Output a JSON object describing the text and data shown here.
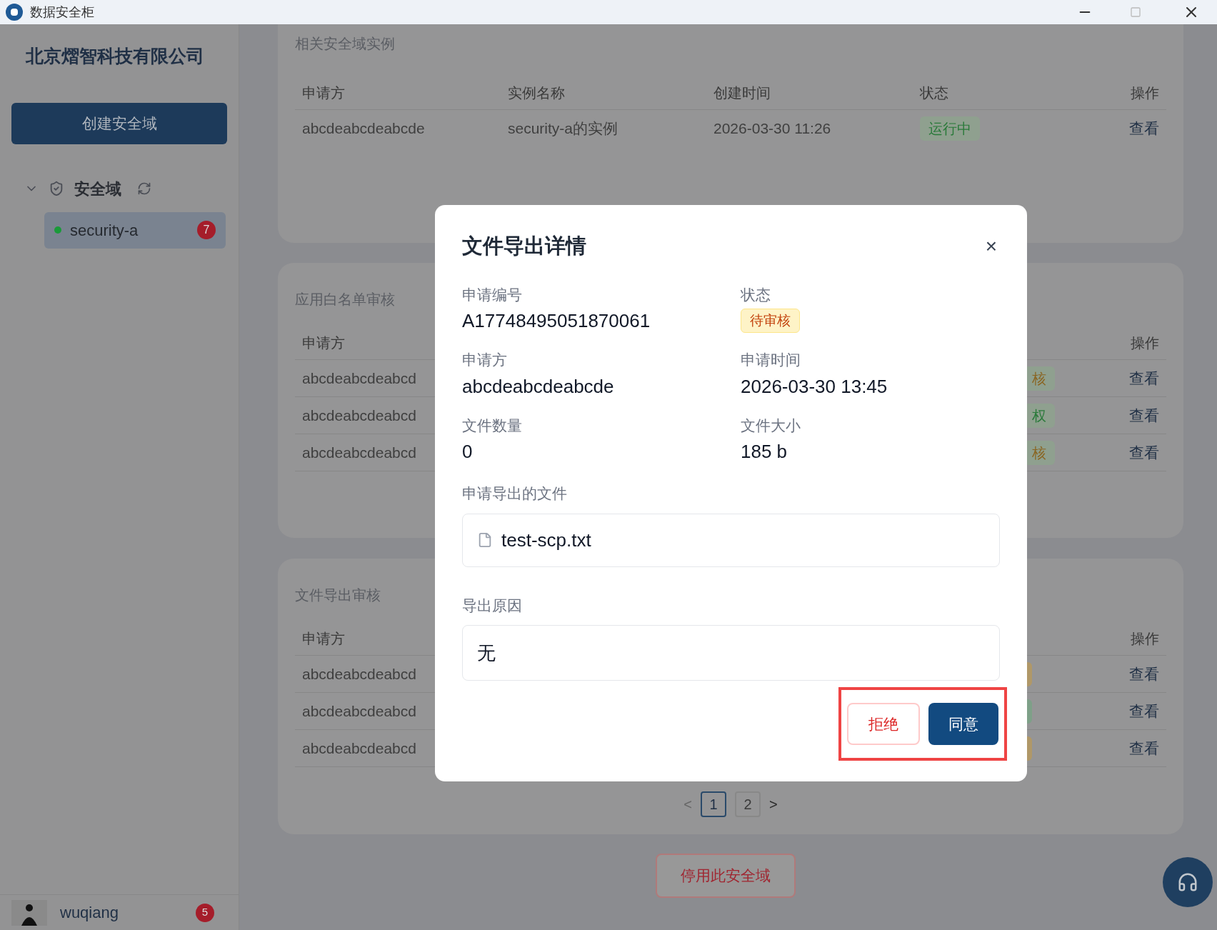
{
  "window": {
    "title": "数据安全柜"
  },
  "sidebar": {
    "company": "北京熠智科技有限公司",
    "create_button": "创建安全域",
    "tree": {
      "label": "安全域",
      "expanded": true,
      "children": [
        {
          "label": "security-a",
          "selected": true,
          "color": "#1a9a3a",
          "badge": "7"
        }
      ]
    },
    "user": {
      "name": "wuqiang",
      "badge": "5"
    }
  },
  "instances_card": {
    "title": "相关安全域实例",
    "columns": [
      "申请方",
      "实例名称",
      "创建时间",
      "状态",
      "操作"
    ],
    "rows": [
      {
        "applicant": "abcdeabcdeabcde",
        "name": "security-a的实例",
        "created": "2026-03-30 11:26",
        "status": "运行中",
        "color": "#2a7a3a",
        "action": "查看"
      }
    ]
  },
  "whitelist_card": {
    "title": "应用白名单审核",
    "columns": [
      "申请方",
      "操作"
    ],
    "rows": [
      {
        "applicant": "abcdeabcdeabcd",
        "status": "核",
        "color": "#8a6420",
        "action": "查看"
      },
      {
        "applicant": "abcdeabcdeabcd",
        "status": "权",
        "color": "#2a7a3a",
        "action": "查看"
      },
      {
        "applicant": "abcdeabcdeabcd",
        "status": "核",
        "color": "#8a6420",
        "action": "查看"
      }
    ]
  },
  "export_card": {
    "title": "文件导出审核",
    "columns": [
      "申请方",
      "操作"
    ],
    "rows": [
      {
        "applicant": "abcdeabcdeabcd",
        "color": "#b09868",
        "action": "查看"
      },
      {
        "applicant": "abcdeabcdeabcd",
        "color": "#7ea088",
        "action": "查看"
      },
      {
        "applicant": "abcdeabcdeabcd",
        "color": "#b09868",
        "action": "查看"
      }
    ],
    "pagination": {
      "prev": "<",
      "pages": [
        {
          "label": "1",
          "selected": true
        },
        {
          "label": "2",
          "selected": false
        }
      ],
      "next": ">"
    }
  },
  "disable_button": "停用此安全域",
  "dialog": {
    "title": "文件导出详情",
    "close": "×",
    "fields": [
      {
        "label": "申请编号",
        "value": "A17748495051870061",
        "kind": "text"
      },
      {
        "label": "状态",
        "value": "待审核",
        "kind": "badge"
      },
      {
        "label": "申请方",
        "value": "abcdeabcdeabcde",
        "kind": "text"
      },
      {
        "label": "申请时间",
        "value": "2026-03-30 13:45",
        "kind": "text"
      },
      {
        "label": "文件数量",
        "value": "0",
        "kind": "text"
      },
      {
        "label": "文件大小",
        "value": "185 b",
        "kind": "text"
      }
    ],
    "files_label": "申请导出的文件",
    "files": [
      "test-scp.txt"
    ],
    "reason_label": "导出原因",
    "reason": "无",
    "reject": "拒绝",
    "approve": "同意",
    "highlighted": true
  }
}
